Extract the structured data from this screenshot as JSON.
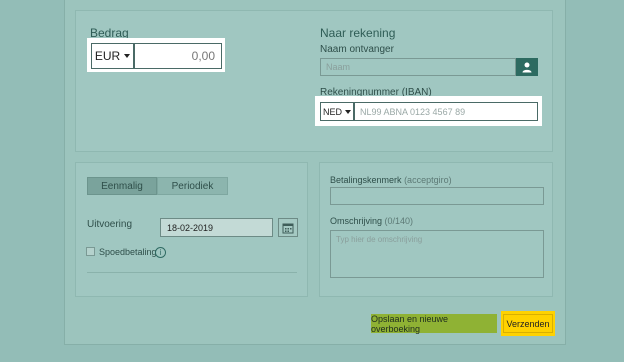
{
  "amount": {
    "section_title": "Bedrag",
    "currency": "EUR",
    "value": "0,00"
  },
  "destination": {
    "section_title": "Naar rekening",
    "recipient_label": "Naam ontvanger",
    "recipient_placeholder": "Naam",
    "iban_label": "Rekeningnummer (IBAN)",
    "iban_country": "NED",
    "iban_placeholder": "NL99 ABNA 0123 4567 89"
  },
  "schedule": {
    "tabs": [
      "Eenmalig",
      "Periodiek"
    ],
    "selected_tab": "Eenmalig",
    "execution_label": "Uitvoering",
    "execution_date": "18-02-2019",
    "urgent_label": "Spoedbetaling"
  },
  "reference": {
    "payment_ref_label": "Betalingskenmerk",
    "payment_ref_hint": "(acceptgiro)",
    "description_label": "Omschrijving",
    "description_count": "(0/140)",
    "description_placeholder": "Typ hier de omschrijving"
  },
  "actions": {
    "save_new_label": "Opslaan en nieuwe overboeking",
    "send_label": "Verzenden"
  },
  "colors": {
    "background": "#93bdb7",
    "accent_dark": "#2d6b61",
    "send_button": "#ffd200",
    "save_button": "#8fb234"
  }
}
